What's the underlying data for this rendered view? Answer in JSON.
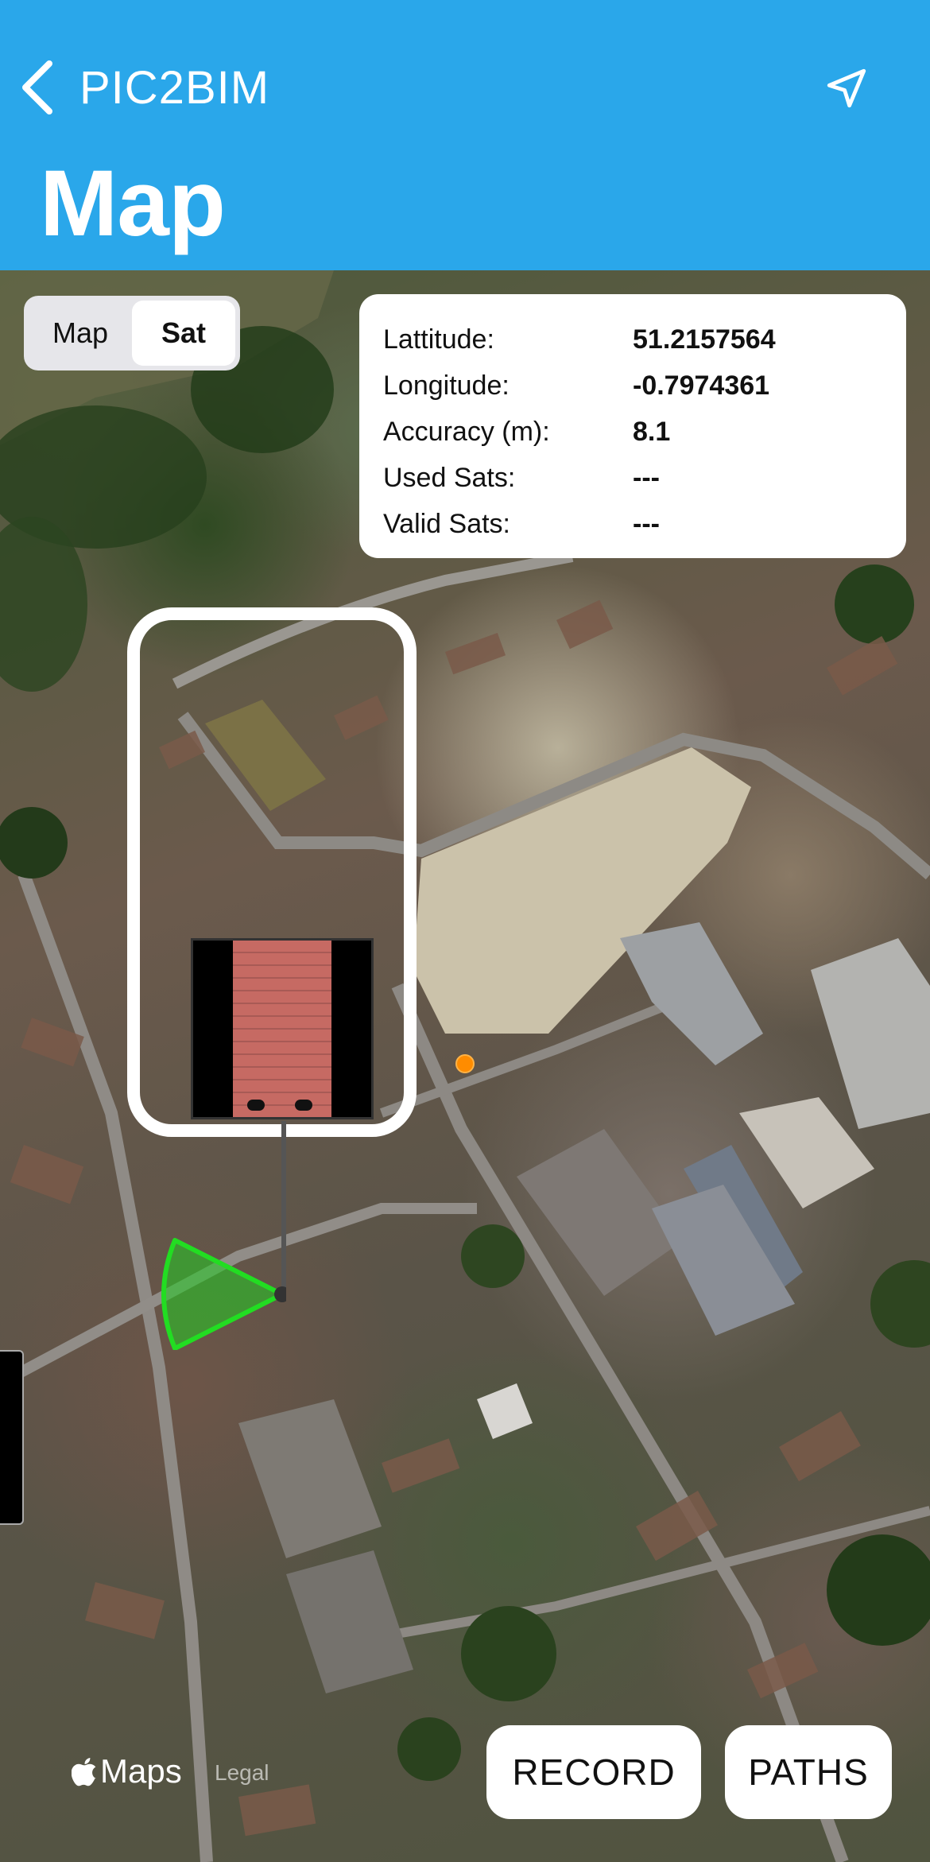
{
  "header": {
    "back_label": "PIC2BIM",
    "title": "Map",
    "background_color": "#2aa7ea"
  },
  "map_type_control": {
    "options": [
      "Map",
      "Sat"
    ],
    "selected": "Sat"
  },
  "location_info": {
    "rows": [
      {
        "label": "Lattitude:",
        "value": "51.2157564"
      },
      {
        "label": "Longitude:",
        "value": "-0.7974361"
      },
      {
        "label": "Accuracy (m):",
        "value": "8.1"
      },
      {
        "label": "Used Sats:",
        "value": "---"
      },
      {
        "label": "Valid Sats:",
        "value": "---"
      }
    ]
  },
  "map": {
    "attribution": "Maps",
    "legal_label": "Legal",
    "current_position_color": "#ff8c00",
    "fov_color": "#22cc22"
  },
  "actions": {
    "record_label": "RECORD",
    "paths_label": "PATHS"
  },
  "icons": {
    "back": "chevron-left-icon",
    "location": "location-arrow-icon",
    "apple": "apple-logo-icon"
  }
}
